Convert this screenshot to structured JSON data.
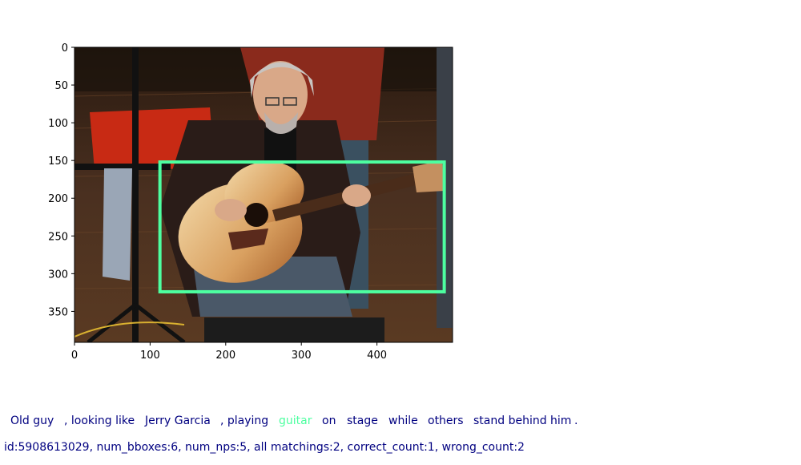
{
  "axes": {
    "x_ticks": [
      "0",
      "100",
      "200",
      "300",
      "400"
    ],
    "y_ticks": [
      "0",
      "50",
      "100",
      "150",
      "200",
      "250",
      "300",
      "350"
    ],
    "x_range": [
      0,
      500
    ],
    "y_range": [
      0,
      391
    ]
  },
  "photo": {
    "description_icon": "photo-musician-guitar",
    "bbox_color": "#4dffa0",
    "bbox_data": {
      "x0": 113,
      "y0": 152,
      "x1": 489,
      "y1": 324
    }
  },
  "caption": {
    "tokens": [
      {
        "text": "Old guy",
        "highlight": false
      },
      {
        "text": ", looking like",
        "highlight": false
      },
      {
        "text": "Jerry Garcia",
        "highlight": false
      },
      {
        "text": ", playing",
        "highlight": false
      },
      {
        "text": "guitar",
        "highlight": true
      },
      {
        "text": "on",
        "highlight": false
      },
      {
        "text": "stage",
        "highlight": false
      },
      {
        "text": "while",
        "highlight": false
      },
      {
        "text": "others",
        "highlight": false
      },
      {
        "text": "stand behind him",
        "highlight": false
      },
      {
        "text": ".",
        "highlight": false
      }
    ],
    "default_color": "#000080",
    "highlight_color": "#4dffa0"
  },
  "meta": {
    "text": "id:5908613029, num_bboxes:6, num_nps:5, all matchings:2, correct_count:1, wrong_count:2"
  }
}
